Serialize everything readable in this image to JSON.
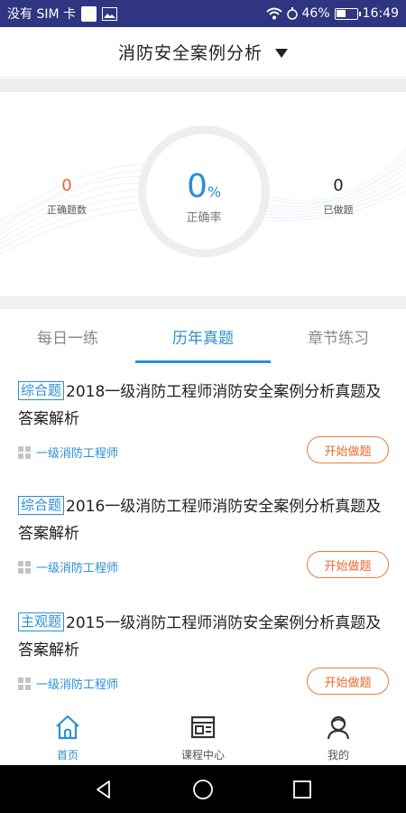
{
  "status_bar": {
    "carrier": "没有 SIM 卡",
    "battery_percent": "46%",
    "battery_level": 0.46,
    "time": "16:49"
  },
  "header": {
    "title": "消防安全案例分析"
  },
  "stats": {
    "correct_count": "0",
    "correct_count_label": "正确题数",
    "accuracy_value": "0",
    "accuracy_unit": "%",
    "accuracy_label": "正确率",
    "done_count": "0",
    "done_count_label": "已做题"
  },
  "tabs": [
    {
      "label": "每日一练",
      "active": false
    },
    {
      "label": "历年真题",
      "active": true
    },
    {
      "label": "章节练习",
      "active": false
    }
  ],
  "exams": [
    {
      "tag": "综合题",
      "title": "2018一级消防工程师消防安全案例分析真题及答案解析",
      "category": "一级消防工程师",
      "button": "开始做题"
    },
    {
      "tag": "综合题",
      "title": "2016一级消防工程师消防安全案例分析真题及答案解析",
      "category": "一级消防工程师",
      "button": "开始做题"
    },
    {
      "tag": "主观题",
      "title": "2015一级消防工程师消防安全案例分析真题及答案解析",
      "category": "一级消防工程师",
      "button": "开始做题"
    }
  ],
  "bottom_nav": [
    {
      "label": "首页",
      "icon": "home-icon",
      "active": true
    },
    {
      "label": "课程中心",
      "icon": "course-icon",
      "active": false
    },
    {
      "label": "我的",
      "icon": "profile-icon",
      "active": false
    }
  ],
  "colors": {
    "status_bar": "#2f3580",
    "accent": "#2b8fd6",
    "correct_count": "#e8692c",
    "button_orange": "#e8692c"
  }
}
